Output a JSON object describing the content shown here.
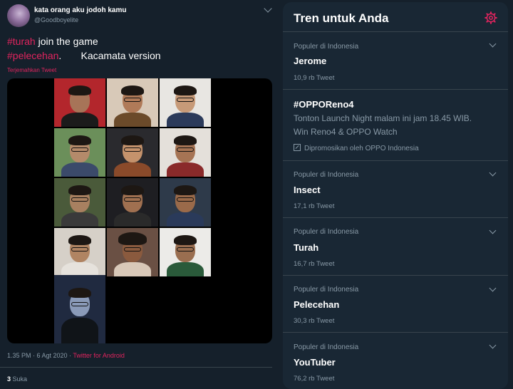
{
  "tweet": {
    "display_name": "kata orang aku jodoh kamu",
    "handle": "@Goodboyelite",
    "hashtag1": "#turah",
    "line1_rest": " join the game",
    "hashtag2": "#pelecehan",
    "line2_rest": ".       Kacamata version",
    "translate": "Terjemahkan Tweet",
    "timestamp": "1.35 PM · 6 Agt 2020 · ",
    "source": "Twitter for Android",
    "likes_count": "3",
    "likes_label": " Suka"
  },
  "trends": {
    "title": "Tren untuk Anda",
    "items": [
      {
        "category": "Populer di Indonesia",
        "name": "Jerome",
        "count": "10,9 rb Tweet"
      },
      {
        "category": "Populer di Indonesia",
        "name": "Insect",
        "count": "17,1 rb Tweet"
      },
      {
        "category": "Populer di Indonesia",
        "name": "Turah",
        "count": "16,7 rb Tweet"
      },
      {
        "category": "Populer di Indonesia",
        "name": "Pelecehan",
        "count": "30,3 rb Tweet"
      },
      {
        "category": "Populer di Indonesia",
        "name": "YouTuber",
        "count": "76,2 rb Tweet"
      }
    ],
    "promoted": {
      "name": "#OPPOReno4",
      "desc1": "Tonton Launch Night malam ini jam 18.45 WIB.",
      "desc2": "Win Reno4 & OPPO Watch",
      "by": "Dipromosikan oleh OPPO Indonesia"
    }
  },
  "colors": {
    "background": "#15202b",
    "panel": "#192734",
    "accent_pink": "#e0245e",
    "muted": "#8899a6"
  },
  "icons": [
    "chevron-down-icon",
    "gear-icon",
    "promoted-icon"
  ]
}
